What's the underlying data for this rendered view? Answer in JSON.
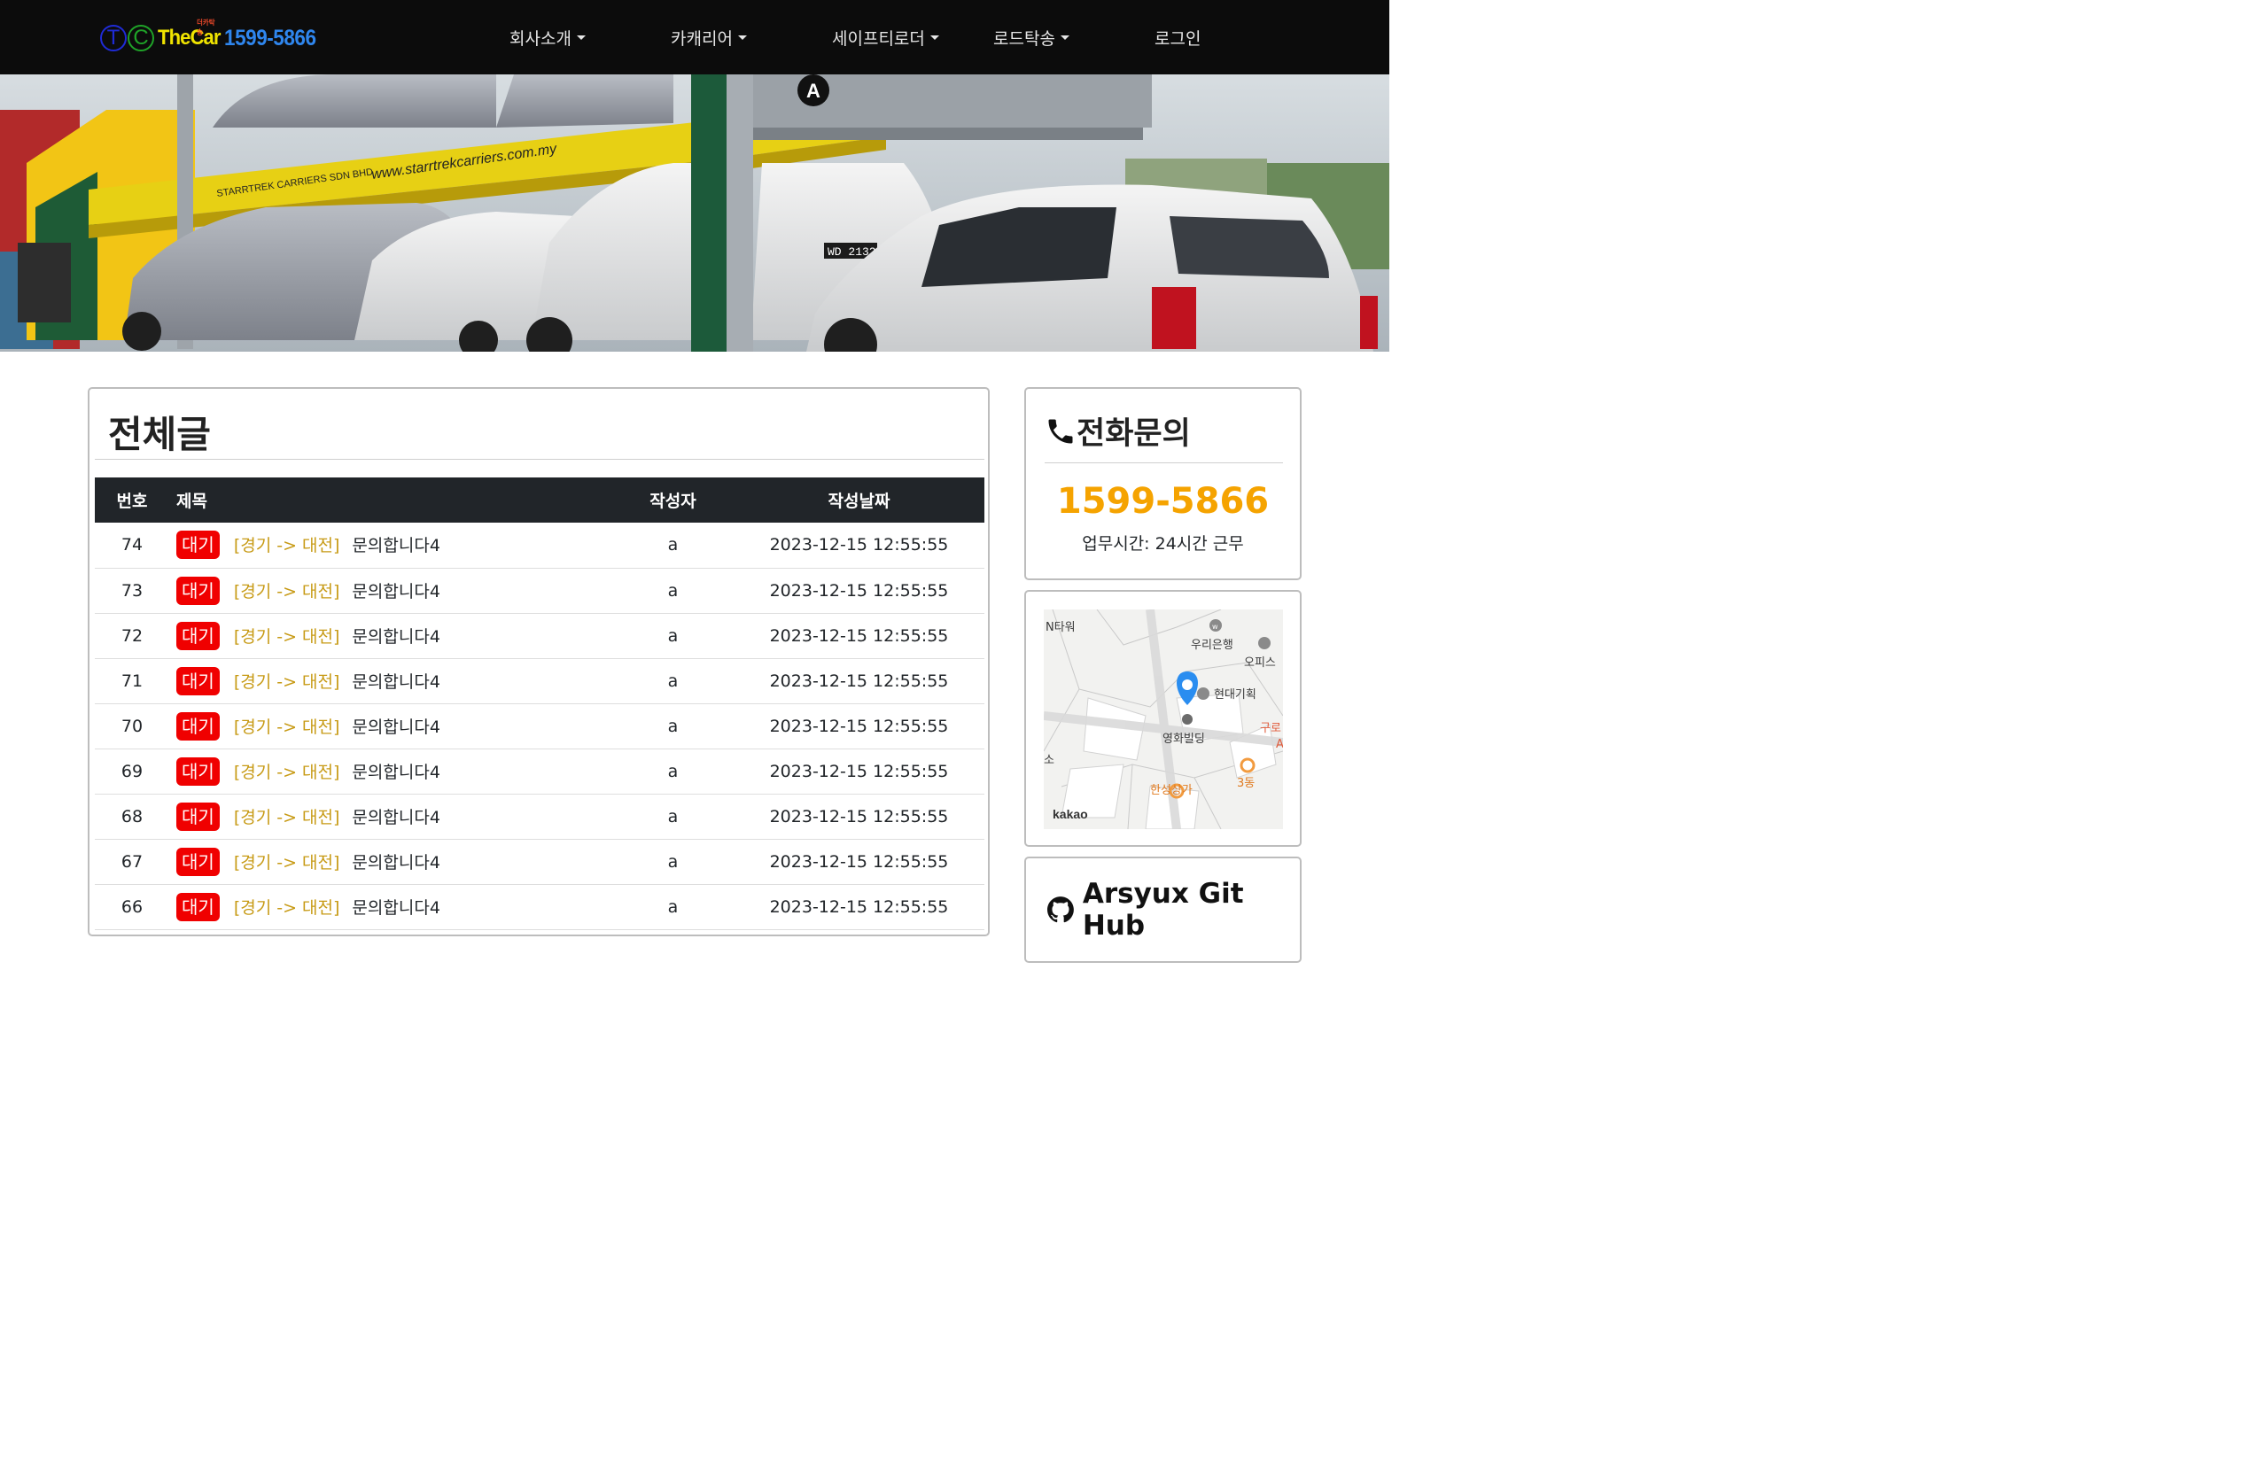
{
  "brand": {
    "letter_t": "T",
    "letter_c": "C",
    "name": "TheCar",
    "tiny_text": "더카탁송",
    "phone": "1599-5866"
  },
  "nav": {
    "items": [
      {
        "label": "회사소개",
        "dropdown": true
      },
      {
        "label": "카캐리어",
        "dropdown": true
      },
      {
        "label": "세이프티로더",
        "dropdown": true
      },
      {
        "label": "로드탁송",
        "dropdown": true
      },
      {
        "label": "로그인",
        "dropdown": false
      }
    ]
  },
  "hero": {
    "image": "car-carrier-truck-photo",
    "truck_text": "www.starrtrekcarriers.com.my",
    "company_text": "STARRTREK CARRIERS SDN BHD",
    "plate": "WD 2132",
    "sign": "A"
  },
  "board": {
    "title": "전체글",
    "columns": {
      "no": "번호",
      "title": "제목",
      "author": "작성자",
      "date": "작성날짜"
    },
    "rows": [
      {
        "no": "74",
        "status": "대기",
        "route": "[경기 -> 대전]",
        "title": "문의합니다4",
        "author": "a",
        "date": "2023-12-15 12:55:55"
      },
      {
        "no": "73",
        "status": "대기",
        "route": "[경기 -> 대전]",
        "title": "문의합니다4",
        "author": "a",
        "date": "2023-12-15 12:55:55"
      },
      {
        "no": "72",
        "status": "대기",
        "route": "[경기 -> 대전]",
        "title": "문의합니다4",
        "author": "a",
        "date": "2023-12-15 12:55:55"
      },
      {
        "no": "71",
        "status": "대기",
        "route": "[경기 -> 대전]",
        "title": "문의합니다4",
        "author": "a",
        "date": "2023-12-15 12:55:55"
      },
      {
        "no": "70",
        "status": "대기",
        "route": "[경기 -> 대전]",
        "title": "문의합니다4",
        "author": "a",
        "date": "2023-12-15 12:55:55"
      },
      {
        "no": "69",
        "status": "대기",
        "route": "[경기 -> 대전]",
        "title": "문의합니다4",
        "author": "a",
        "date": "2023-12-15 12:55:55"
      },
      {
        "no": "68",
        "status": "대기",
        "route": "[경기 -> 대전]",
        "title": "문의합니다4",
        "author": "a",
        "date": "2023-12-15 12:55:55"
      },
      {
        "no": "67",
        "status": "대기",
        "route": "[경기 -> 대전]",
        "title": "문의합니다4",
        "author": "a",
        "date": "2023-12-15 12:55:55"
      },
      {
        "no": "66",
        "status": "대기",
        "route": "[경기 -> 대전]",
        "title": "문의합니다4",
        "author": "a",
        "date": "2023-12-15 12:55:55"
      }
    ]
  },
  "sidebar": {
    "phone_card": {
      "icon": "phone-icon",
      "title": "전화문의",
      "number": "1599-5866",
      "hours": "업무시간: 24시간 근무"
    },
    "map_card": {
      "labels": {
        "tower": "N타워",
        "bank": "우리은행",
        "office": "오피스",
        "company": "현대기획",
        "building": "영화빌딩",
        "guro": "구로",
        "guro_a": "A",
        "so": "소",
        "mall": "한성상가",
        "dong": "3동",
        "logo": "kakao"
      }
    },
    "git_card": {
      "icon": "github-icon",
      "title": "Arsyux Git Hub"
    }
  },
  "colors": {
    "navbar_bg": "#0c0c0c",
    "badge": "#f00000",
    "route": "#c79a14",
    "phone_number": "#f5a300",
    "table_header": "#212529"
  }
}
